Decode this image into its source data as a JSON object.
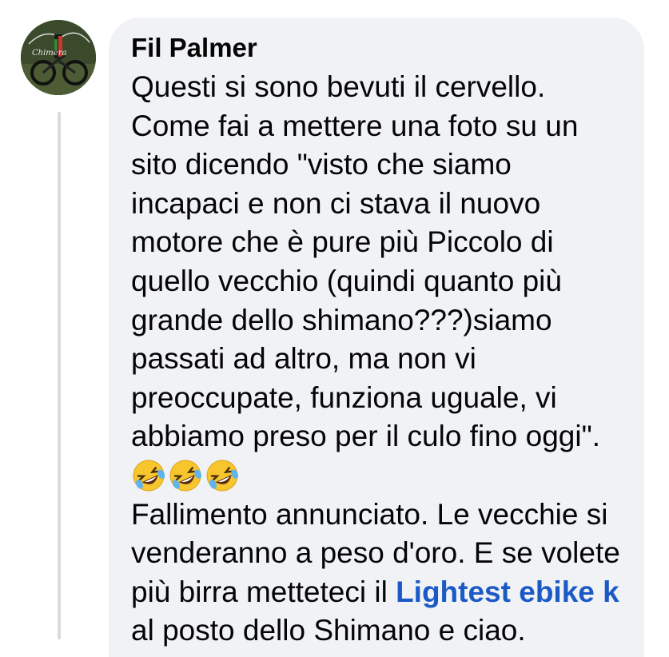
{
  "comment": {
    "author": "Fil Palmer",
    "avatar_text": "Chimera",
    "lines": [
      "Questi si sono bevuti il cervello.",
      "Come fai a mettere una foto su un",
      "sito dicendo \"visto che siamo",
      "incapaci e non ci stava il nuovo",
      "motore che è pure più Piccolo di",
      "quello vecchio (quindi quanto più",
      "grande dello shimano???)siamo",
      "passati ad altro, ma non vi",
      "preoccupate, funziona uguale, vi",
      "abbiamo preso per il culo fino oggi\"."
    ],
    "emoji": [
      "rolling-on-floor-laughing",
      "rolling-on-floor-laughing",
      "rolling-on-floor-laughing"
    ],
    "lines_after": [
      "Fallimento annunciato. Le vecchie si",
      "venderanno a peso d'oro. E se volete"
    ],
    "link_line_prefix": "più birra metteteci il ",
    "link_text": "Lightest ebike kit",
    "last_line": "al posto dello Shimano e ciao."
  },
  "colors": {
    "bubble": "#f0f2f5",
    "text": "#050505",
    "link": "#1b5ac6",
    "thread_line": "#d8dadf"
  }
}
